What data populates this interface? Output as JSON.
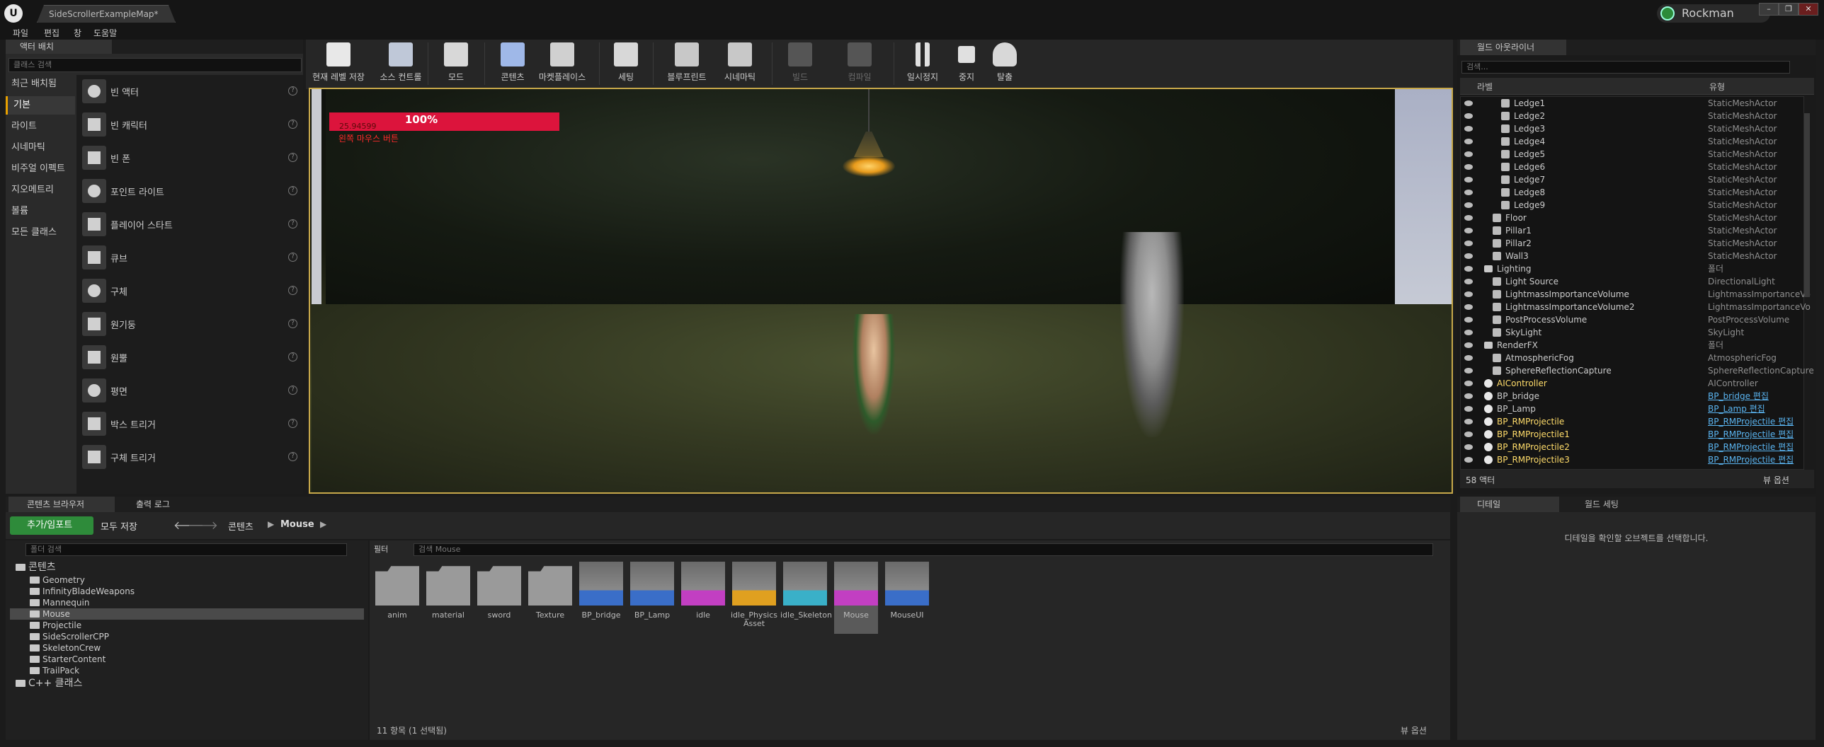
{
  "window": {
    "doc_tab": "SideScrollerExampleMap*",
    "user": "Rockman",
    "controls": [
      "–",
      "❐",
      "✕"
    ]
  },
  "menu": [
    "파일",
    "편집",
    "창",
    "도움말"
  ],
  "place_panel": {
    "tab": "액터 배치",
    "search_placeholder": "클래스 검색",
    "categories": [
      "최근 배치됨",
      "기본",
      "라이트",
      "시네마틱",
      "비주얼 이펙트",
      "지오메트리",
      "볼륨",
      "모든 클래스"
    ],
    "selected_category": "기본",
    "items": [
      "빈 액터",
      "빈 캐릭터",
      "빈 폰",
      "포인트 라이트",
      "플레이어 스타트",
      "큐브",
      "구체",
      "원기둥",
      "원뿔",
      "평면",
      "박스 트리거",
      "구체 트리거"
    ]
  },
  "toolbar": {
    "buttons": [
      {
        "label": "현재 레벨 저장",
        "icon": "save-icon",
        "enabled": true
      },
      {
        "label": "소스 컨트롤",
        "icon": "source-control-icon",
        "enabled": true
      },
      {
        "label": "모드",
        "icon": "modes-icon",
        "enabled": true
      },
      {
        "label": "콘텐츠",
        "icon": "content-icon",
        "enabled": true
      },
      {
        "label": "마켓플레이스",
        "icon": "marketplace-icon",
        "enabled": true
      },
      {
        "label": "세팅",
        "icon": "settings-icon",
        "enabled": true
      },
      {
        "label": "블루프린트",
        "icon": "blueprint-icon",
        "enabled": true
      },
      {
        "label": "시네마틱",
        "icon": "cinematics-icon",
        "enabled": true
      },
      {
        "label": "빌드",
        "icon": "build-icon",
        "enabled": false
      },
      {
        "label": "컴파일",
        "icon": "compile-icon",
        "enabled": false
      },
      {
        "label": "일시정지",
        "icon": "pause-icon",
        "enabled": true
      },
      {
        "label": "중지",
        "icon": "stop-icon",
        "enabled": true
      },
      {
        "label": "탈출",
        "icon": "eject-icon",
        "enabled": true
      }
    ]
  },
  "viewport": {
    "hp_percent": "100%",
    "hp_value": "25.94599",
    "hint": "왼쪽 마우스 버튼"
  },
  "outliner": {
    "tab": "월드 아웃라이너",
    "search_placeholder": "검색...",
    "col_label": "라벨",
    "col_type": "유형",
    "rows": [
      {
        "label": "Ledge1",
        "type": "StaticMeshActor",
        "indent": 3
      },
      {
        "label": "Ledge2",
        "type": "StaticMeshActor",
        "indent": 3
      },
      {
        "label": "Ledge3",
        "type": "StaticMeshActor",
        "indent": 3
      },
      {
        "label": "Ledge4",
        "type": "StaticMeshActor",
        "indent": 3
      },
      {
        "label": "Ledge5",
        "type": "StaticMeshActor",
        "indent": 3
      },
      {
        "label": "Ledge6",
        "type": "StaticMeshActor",
        "indent": 3
      },
      {
        "label": "Ledge7",
        "type": "StaticMeshActor",
        "indent": 3
      },
      {
        "label": "Ledge8",
        "type": "StaticMeshActor",
        "indent": 3
      },
      {
        "label": "Ledge9",
        "type": "StaticMeshActor",
        "indent": 3
      },
      {
        "label": "Floor",
        "type": "StaticMeshActor",
        "indent": 2
      },
      {
        "label": "Pillar1",
        "type": "StaticMeshActor",
        "indent": 2
      },
      {
        "label": "Pillar2",
        "type": "StaticMeshActor",
        "indent": 2
      },
      {
        "label": "Wall3",
        "type": "StaticMeshActor",
        "indent": 2
      },
      {
        "label": "Lighting",
        "type": "폴더",
        "indent": 1,
        "folder": true
      },
      {
        "label": "Light Source",
        "type": "DirectionalLight",
        "indent": 2
      },
      {
        "label": "LightmassImportanceVolume",
        "type": "LightmassImportanceVo",
        "indent": 2
      },
      {
        "label": "LightmassImportanceVolume2",
        "type": "LightmassImportanceVo",
        "indent": 2
      },
      {
        "label": "PostProcessVolume",
        "type": "PostProcessVolume",
        "indent": 2
      },
      {
        "label": "SkyLight",
        "type": "SkyLight",
        "indent": 2
      },
      {
        "label": "RenderFX",
        "type": "폴더",
        "indent": 1,
        "folder": true
      },
      {
        "label": "AtmosphericFog",
        "type": "AtmosphericFog",
        "indent": 2
      },
      {
        "label": "SphereReflectionCapture",
        "type": "SphereReflectionCapture",
        "indent": 2
      },
      {
        "label": "AIController",
        "type": "AIController",
        "indent": 1,
        "highlight": true
      },
      {
        "label": "BP_bridge",
        "type": "BP_bridge 편집",
        "indent": 1,
        "link": true
      },
      {
        "label": "BP_Lamp",
        "type": "BP_Lamp 편집",
        "indent": 1,
        "link": true
      },
      {
        "label": "BP_RMProjectile",
        "type": "BP_RMProjectile 편집",
        "indent": 1,
        "link": true,
        "highlight": true
      },
      {
        "label": "BP_RMProjectile1",
        "type": "BP_RMProjectile 편집",
        "indent": 1,
        "link": true,
        "highlight": true
      },
      {
        "label": "BP_RMProjectile2",
        "type": "BP_RMProjectile 편집",
        "indent": 1,
        "link": true,
        "highlight": true
      },
      {
        "label": "BP_RMProjectile3",
        "type": "BP_RMProjectile 편집",
        "indent": 1,
        "link": true,
        "highlight": true
      }
    ],
    "count": "58 액터",
    "view_options": "뷰 옵션"
  },
  "content_browser": {
    "tabs": [
      "콘텐츠 브라우저",
      "출력 로그"
    ],
    "add_import": "추가/임포트",
    "save_all": "모두 저장",
    "crumb_root": "콘텐츠",
    "crumb_current": "Mouse",
    "tree_search_placeholder": "폴더 검색",
    "tree": [
      {
        "label": "콘텐츠",
        "level": 0
      },
      {
        "label": "Geometry",
        "level": 1
      },
      {
        "label": "InfinityBladeWeapons",
        "level": 1
      },
      {
        "label": "Mannequin",
        "level": 1
      },
      {
        "label": "Mouse",
        "level": 1,
        "selected": true
      },
      {
        "label": "Projectile",
        "level": 1
      },
      {
        "label": "SideScrollerCPP",
        "level": 1
      },
      {
        "label": "SkeletonCrew",
        "level": 1
      },
      {
        "label": "StarterContent",
        "level": 1
      },
      {
        "label": "TrailPack",
        "level": 1
      },
      {
        "label": "C++ 클래스",
        "level": 0
      }
    ],
    "filter_label": "필터",
    "asset_search_placeholder": "검색 Mouse",
    "assets": [
      {
        "label": "anim",
        "kind": "folder"
      },
      {
        "label": "material",
        "kind": "folder"
      },
      {
        "label": "sword",
        "kind": "folder"
      },
      {
        "label": "Texture",
        "kind": "folder"
      },
      {
        "label": "BP_bridge",
        "kind": "blueprint",
        "color": "#3a6ec8"
      },
      {
        "label": "BP_Lamp",
        "kind": "blueprint",
        "color": "#3a6ec8"
      },
      {
        "label": "idle",
        "kind": "anim",
        "color": "#c23fc2"
      },
      {
        "label": "idle_Physics Asset",
        "kind": "physics",
        "color": "#e0a020"
      },
      {
        "label": "idle_Skeleton",
        "kind": "skeleton",
        "color": "#3ab0c8"
      },
      {
        "label": "Mouse",
        "kind": "mesh",
        "color": "#c23fc2",
        "selected": true
      },
      {
        "label": "MouseUI",
        "kind": "widget",
        "color": "#3a6ec8"
      }
    ],
    "status": "11 항목 (1 선택됨)",
    "view_options": "뷰 옵션"
  },
  "details": {
    "tab_details": "디테일",
    "tab_world": "월드 세팅",
    "message": "디테일을 확인할 오브젝트를 선택합니다."
  }
}
